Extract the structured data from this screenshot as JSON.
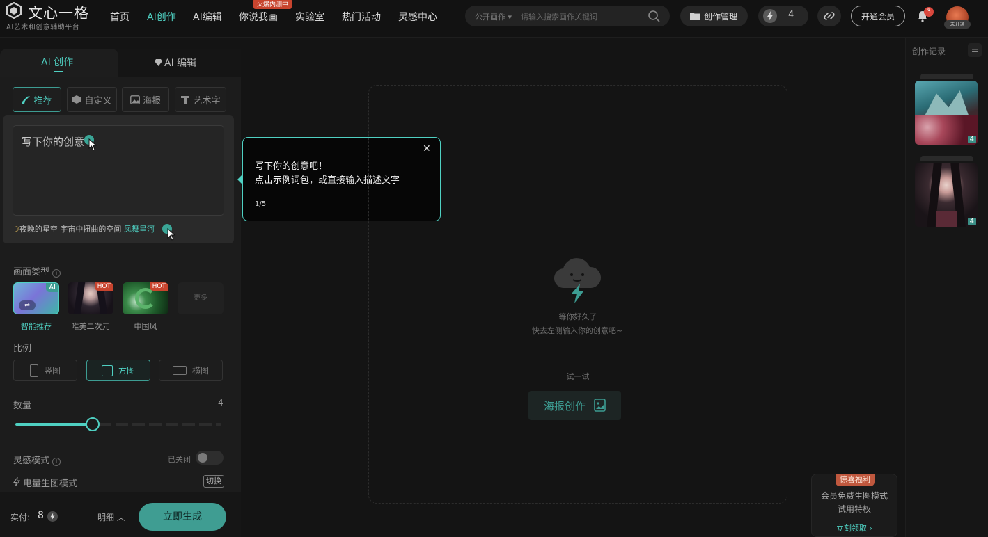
{
  "brand": {
    "name": "文心一格",
    "subtitle": "AI艺术和创意辅助平台"
  },
  "nav": {
    "items": [
      {
        "label": "首页",
        "active": false
      },
      {
        "label": "AI创作",
        "active": true
      },
      {
        "label": "AI编辑",
        "active": false
      },
      {
        "label": "你说我画",
        "active": false,
        "badge": "火爆内测中"
      },
      {
        "label": "实验室",
        "active": false
      },
      {
        "label": "热门活动",
        "active": false
      },
      {
        "label": "灵感中心",
        "active": false
      }
    ]
  },
  "search": {
    "scope": "公开画作",
    "placeholder": "请输入搜索画作关键词"
  },
  "header_actions": {
    "manage": "创作管理",
    "energy": "4",
    "vip": "开通会员",
    "notifications": "3",
    "avatar_badge": "未开通"
  },
  "left": {
    "tabs": {
      "create": "AI 创作",
      "edit": "AI 编辑"
    },
    "modes": [
      "推荐",
      "自定义",
      "海报",
      "艺术字"
    ],
    "prompt": {
      "text": "写下你的创意",
      "hint_prefix": "夜晚的星空 宇宙中扭曲的空间",
      "hint_link": "凤舞星河"
    },
    "picture_type": {
      "title": "画面类型",
      "options": [
        {
          "label": "智能推荐",
          "badge": "AI",
          "active": true
        },
        {
          "label": "唯美二次元",
          "badge": "HOT",
          "active": false
        },
        {
          "label": "中国风",
          "badge": "HOT",
          "active": false
        },
        {
          "label": "更多",
          "badge": "",
          "active": false
        }
      ]
    },
    "ratio": {
      "title": "比例",
      "options": [
        {
          "label": "竖图",
          "active": false
        },
        {
          "label": "方图",
          "active": true
        },
        {
          "label": "横图",
          "active": false
        }
      ]
    },
    "quantity": {
      "title": "数量",
      "value": "4",
      "level": 0.5
    },
    "inspiration": {
      "title": "灵感模式",
      "state": "已关闭"
    },
    "power_mode": {
      "title": "电量生图模式",
      "action": "切换"
    },
    "footer": {
      "pay_label": "实付:",
      "pay_value": "8",
      "detail": "明细",
      "generate": "立即生成"
    }
  },
  "tooltip": {
    "line1": "写下你的创意吧！",
    "line2": "点击示例词包，或直接输入描述文字",
    "step": "1/5"
  },
  "center": {
    "wait": "等你好久了",
    "hint": "快去左侧输入你的创意吧~",
    "try": "试一试",
    "poster": "海报创作"
  },
  "right": {
    "title": "创作记录",
    "items": [
      {
        "count": "4"
      },
      {
        "count": "4"
      }
    ]
  },
  "promo": {
    "badge": "惊喜福利",
    "line1": "会员免费生图模式",
    "line2": "试用特权",
    "link": "立刻领取"
  },
  "colors": {
    "accent": "#4fd0c2",
    "background": "#141414",
    "badge_red": "#c8442e"
  }
}
